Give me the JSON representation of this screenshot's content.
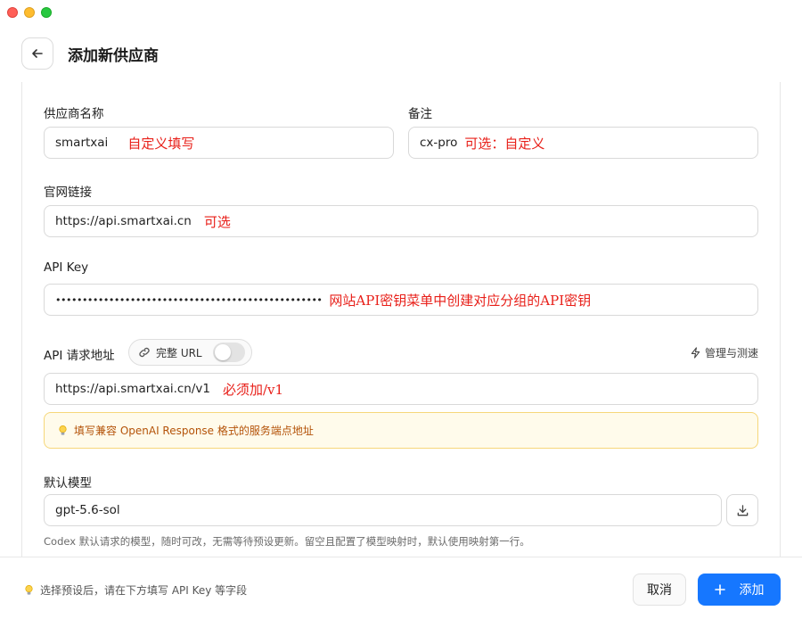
{
  "header": {
    "title": "添加新供应商"
  },
  "form": {
    "provider_name": {
      "label": "供应商名称",
      "value": "smartxai",
      "note": "自定义填写"
    },
    "remark": {
      "label": "备注",
      "value": "cx-pro",
      "note": "可选：自定义"
    },
    "website": {
      "label": "官网链接",
      "value": "https://api.smartxai.cn",
      "note": "可选"
    },
    "api_key": {
      "label": "API Key",
      "value": "••••••••••••••••••••••••••••••••••••••••••••••••••",
      "note": "网站API密钥菜单中创建对应分组的API密钥"
    },
    "api_url": {
      "label": "API 请求地址",
      "toggle_label": "完整 URL",
      "toggle_on": false,
      "manage_label": "管理与测速",
      "value": "https://api.smartxai.cn/v1",
      "note": "必须加/v1",
      "hint": "填写兼容 OpenAI Response 格式的服务端点地址"
    },
    "default_model": {
      "label": "默认模型",
      "value": "gpt-5.6-sol",
      "helper": "Codex 默认请求的模型，随时可改，无需等待预设更新。留空且配置了模型映射时，默认使用映射第一行。"
    }
  },
  "footer": {
    "hint": "选择预设后，请在下方填写 API Key 等字段",
    "cancel_label": "取消",
    "add_label": "添加"
  },
  "colors": {
    "accent": "#1677ff",
    "annotation": "#e8201a",
    "hint_bg": "#fffbeb",
    "hint_text": "#b45309"
  }
}
